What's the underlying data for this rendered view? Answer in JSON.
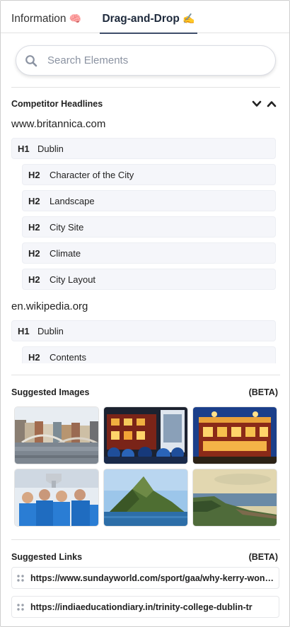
{
  "tabs": [
    {
      "label": "Information",
      "emoji": "🧠"
    },
    {
      "label": "Drag-and-Drop",
      "emoji": "✍️"
    }
  ],
  "search": {
    "placeholder": "Search Elements",
    "value": ""
  },
  "headlines_section": {
    "title": "Competitor Headlines",
    "sources": [
      {
        "domain": "www.britannica.com",
        "headings": [
          {
            "level": "H1",
            "text": "Dublin"
          },
          {
            "level": "H2",
            "text": "Character of the City"
          },
          {
            "level": "H2",
            "text": "Landscape"
          },
          {
            "level": "H2",
            "text": "City Site"
          },
          {
            "level": "H2",
            "text": "Climate"
          },
          {
            "level": "H2",
            "text": "City Layout"
          }
        ]
      },
      {
        "domain": "en.wikipedia.org",
        "headings": [
          {
            "level": "H1",
            "text": "Dublin"
          },
          {
            "level": "H2",
            "text": "Contents"
          }
        ]
      }
    ]
  },
  "images_section": {
    "title": "Suggested Images",
    "badge": "(BETA)",
    "images": [
      {
        "name": "river-bridge-city"
      },
      {
        "name": "pub-night-crowd"
      },
      {
        "name": "pub-night-facade"
      },
      {
        "name": "team-trophy-celebration"
      },
      {
        "name": "island-peak-sea"
      },
      {
        "name": "coastal-cliffs"
      }
    ]
  },
  "links_section": {
    "title": "Suggested Links",
    "badge": "(BETA)",
    "links": [
      {
        "url": "https://www.sundayworld.com/sport/gaa/why-kerry-won-the-all-ireland"
      },
      {
        "url": "https://indiaeducationdiary.in/trinity-college-dublin-tr"
      }
    ]
  },
  "icons": {
    "search": "search-icon",
    "collapse": "chevron-down-icon",
    "expand": "chevron-up-icon",
    "drag": "drag-handle-icon"
  },
  "colors": {
    "active_tab_underline": "#3e4d6a",
    "heading_row_bg": "#f5f6fa",
    "placeholder": "#8b93a2"
  }
}
